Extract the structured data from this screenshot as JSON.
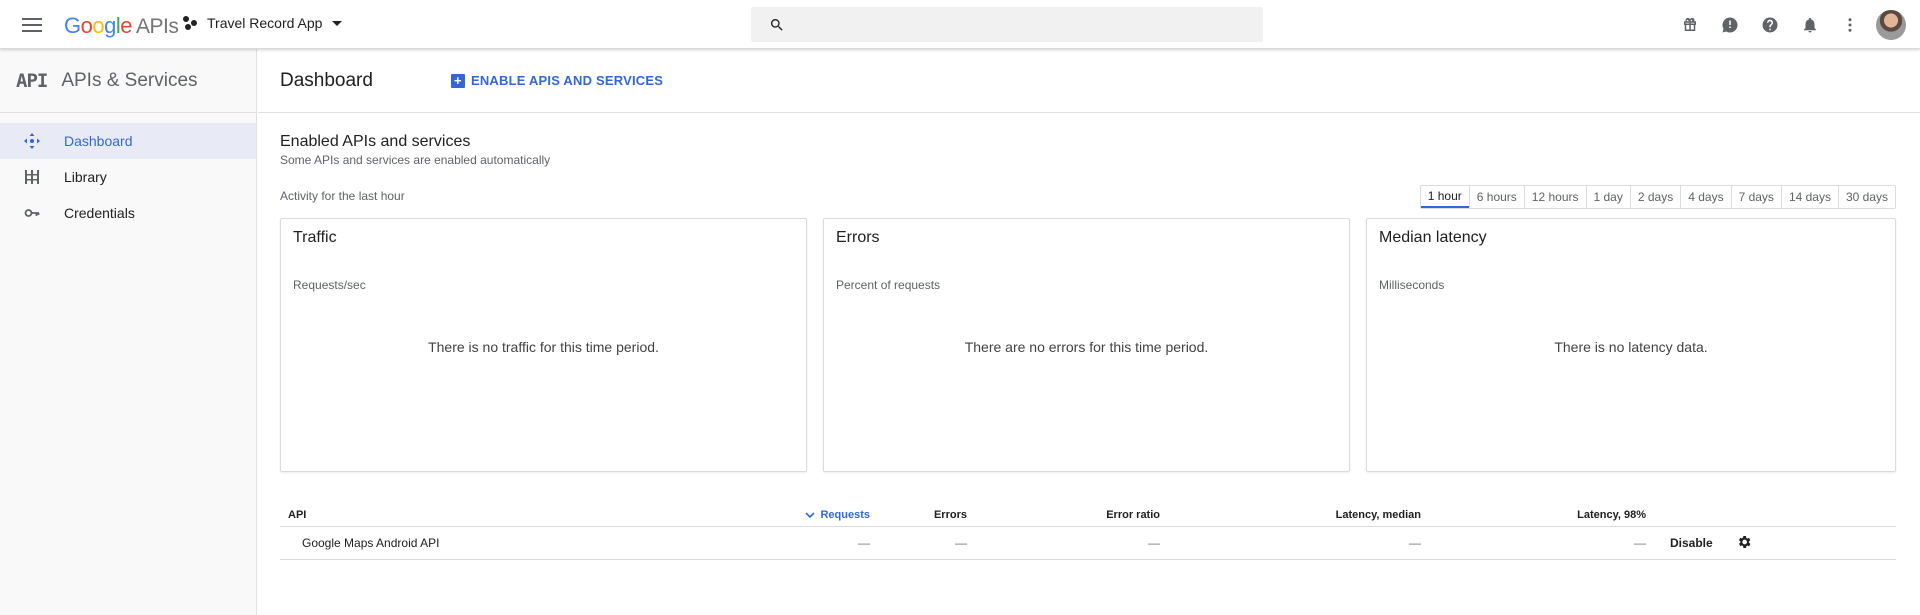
{
  "header": {
    "logo_letters": [
      "G",
      "o",
      "o",
      "g",
      "l",
      "e"
    ],
    "logo_product": "APIs",
    "project_name": "Travel Record App",
    "search_placeholder": ""
  },
  "sidebar": {
    "logo_text": "API",
    "title": "APIs & Services",
    "items": [
      {
        "label": "Dashboard",
        "icon": "dashboard-icon",
        "active": true
      },
      {
        "label": "Library",
        "icon": "library-icon",
        "active": false
      },
      {
        "label": "Credentials",
        "icon": "key-icon",
        "active": false
      }
    ]
  },
  "main": {
    "page_title": "Dashboard",
    "enable_button": "ENABLE APIS AND SERVICES",
    "section_title": "Enabled APIs and services",
    "section_subtitle": "Some APIs and services are enabled automatically",
    "activity_label": "Activity for the last hour",
    "time_ranges": [
      "1 hour",
      "6 hours",
      "12 hours",
      "1 day",
      "2 days",
      "4 days",
      "7 days",
      "14 days",
      "30 days"
    ],
    "selected_range": "1 hour",
    "cards": [
      {
        "title": "Traffic",
        "subtitle": "Requests/sec",
        "message": "There is no traffic for this time period."
      },
      {
        "title": "Errors",
        "subtitle": "Percent of requests",
        "message": "There are no errors for this time period."
      },
      {
        "title": "Median latency",
        "subtitle": "Milliseconds",
        "message": "There is no latency data."
      }
    ],
    "table": {
      "columns": [
        "API",
        "Requests",
        "Errors",
        "Error ratio",
        "Latency, median",
        "Latency, 98%"
      ],
      "rows": [
        {
          "api": "Google Maps Android API",
          "requests": "—",
          "errors": "—",
          "error_ratio": "—",
          "latency_median": "—",
          "latency_98": "—",
          "action": "Disable"
        }
      ]
    }
  },
  "colors": {
    "accent": "#3367d6",
    "active_nav_bg": "#e8eaf6",
    "sidebar_bg": "#f9f9f9"
  }
}
